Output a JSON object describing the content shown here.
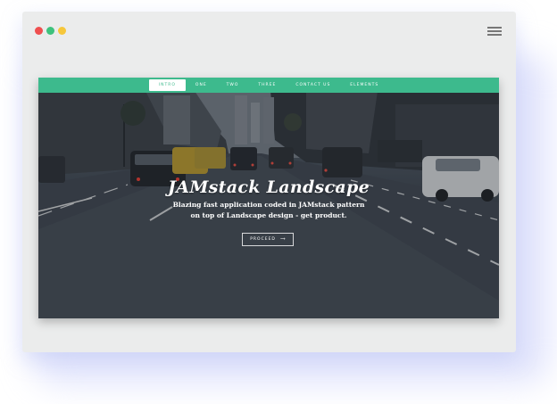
{
  "nav": {
    "items": [
      {
        "label": "Intro",
        "active": true
      },
      {
        "label": "One",
        "active": false
      },
      {
        "label": "Two",
        "active": false
      },
      {
        "label": "Three",
        "active": false
      },
      {
        "label": "Contact Us",
        "active": false
      },
      {
        "label": "Elements",
        "active": false
      }
    ]
  },
  "hero": {
    "title": "JAMstack Landscape",
    "tagline": "Blazing fast application coded in JAMstack pattern on top of Landscape design - get product.",
    "cta_label": "Proceed",
    "cta_icon": "arrow-right-icon"
  },
  "window": {
    "controls": [
      "close-dot",
      "maximize-dot",
      "minimize-dot"
    ],
    "menu_icon": "hamburger-menu-icon"
  },
  "colors": {
    "accent": "#3dba8d",
    "frame": "#ebecec",
    "dot_red": "#ef4f4f",
    "dot_green": "#3ec27d",
    "dot_yellow": "#f6c73b"
  }
}
